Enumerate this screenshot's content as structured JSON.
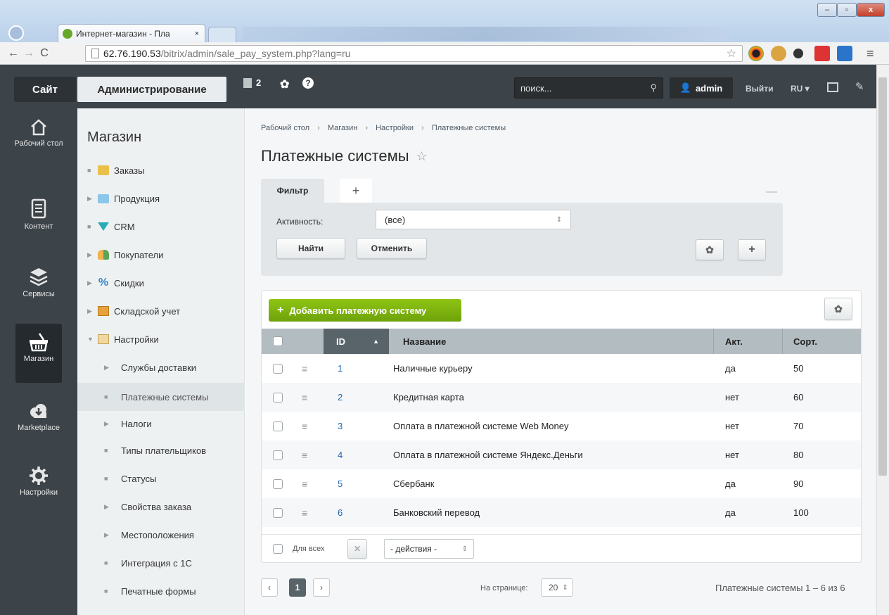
{
  "browser": {
    "tab_title": "Интернет-магазин - Пла",
    "tab_close": "×",
    "url_host": "62.76.190.53",
    "url_path": "/bitrix/admin/sale_pay_system.php?lang=ru",
    "win_min": "–",
    "win_max": "▫",
    "win_close": "x"
  },
  "adminbar": {
    "site_label": "Сайт",
    "admin_label": "Администрирование",
    "notify_count": "2",
    "search_placeholder": "поиск...",
    "user_label": "admin",
    "logout_label": "Выйти",
    "lang_label": "RU"
  },
  "leftpanel": {
    "items": [
      {
        "label": "Рабочий стол",
        "icon": "home-icon"
      },
      {
        "label": "Контент",
        "icon": "document-icon"
      },
      {
        "label": "Сервисы",
        "icon": "layers-icon"
      },
      {
        "label": "Магазин",
        "icon": "basket-icon"
      },
      {
        "label": "Marketplace",
        "icon": "cloud-download-icon"
      },
      {
        "label": "Настройки",
        "icon": "gear-icon"
      }
    ]
  },
  "menu": {
    "title": "Магазин",
    "items": [
      {
        "label": "Заказы",
        "marker": "■",
        "icon": "folder-icon"
      },
      {
        "label": "Продукция",
        "marker": "▶",
        "icon": "folder-icon"
      },
      {
        "label": "CRM",
        "marker": "■",
        "icon": "funnel-icon"
      },
      {
        "label": "Покупатели",
        "marker": "▶",
        "icon": "users-icon"
      },
      {
        "label": "Скидки",
        "marker": "▶",
        "icon": "percent-icon"
      },
      {
        "label": "Складской учет",
        "marker": "▶",
        "icon": "warehouse-icon"
      },
      {
        "label": "Настройки",
        "marker": "▼",
        "icon": "settings-folder-icon"
      },
      {
        "label": "Службы доставки",
        "marker": "▶"
      },
      {
        "label": "Платежные системы",
        "marker": "■"
      },
      {
        "label": "Налоги",
        "marker": "▶"
      },
      {
        "label": "Типы плательщиков",
        "marker": "■"
      },
      {
        "label": "Статусы",
        "marker": "■"
      },
      {
        "label": "Свойства заказа",
        "marker": "▶"
      },
      {
        "label": "Местоположения",
        "marker": "▶"
      },
      {
        "label": "Интеграция с 1С",
        "marker": "■"
      },
      {
        "label": "Печатные формы",
        "marker": "■"
      }
    ]
  },
  "breadcrumb": [
    "Рабочий стол",
    "Магазин",
    "Настройки",
    "Платежные системы"
  ],
  "breadcrumb_sep": "›",
  "page_title": "Платежные системы",
  "filter": {
    "tab_label": "Фильтр",
    "add_tab": "+",
    "activity_label": "Активность:",
    "activity_value": "(все)",
    "find_label": "Найти",
    "cancel_label": "Отменить",
    "plus": "+"
  },
  "grid": {
    "add_label": "Добавить платежную систему",
    "columns": {
      "id": "ID",
      "name": "Название",
      "active": "Акт.",
      "sort": "Сорт."
    },
    "rows": [
      {
        "id": "1",
        "name": "Наличные курьеру",
        "active": "да",
        "sort": "50"
      },
      {
        "id": "2",
        "name": "Кредитная карта",
        "active": "нет",
        "sort": "60"
      },
      {
        "id": "3",
        "name": "Оплата в платежной системе Web Money",
        "active": "нет",
        "sort": "70"
      },
      {
        "id": "4",
        "name": "Оплата в платежной системе Яндекс.Деньги",
        "active": "нет",
        "sort": "80"
      },
      {
        "id": "5",
        "name": "Сбербанк",
        "active": "да",
        "sort": "90"
      },
      {
        "id": "6",
        "name": "Банковский перевод",
        "active": "да",
        "sort": "100"
      }
    ],
    "for_all_label": "Для всех",
    "actions_label": "- действия -"
  },
  "pagination": {
    "prev": "‹",
    "current": "1",
    "next": "›",
    "per_page_label": "На странице:",
    "per_page_value": "20",
    "summary": "Платежные системы 1 – 6 из 6"
  },
  "colors": {
    "adminbar_bg": "#3c4349",
    "add_button_green": "#7db30e",
    "link_blue": "#2067b0",
    "header_dark": "#59636a"
  }
}
